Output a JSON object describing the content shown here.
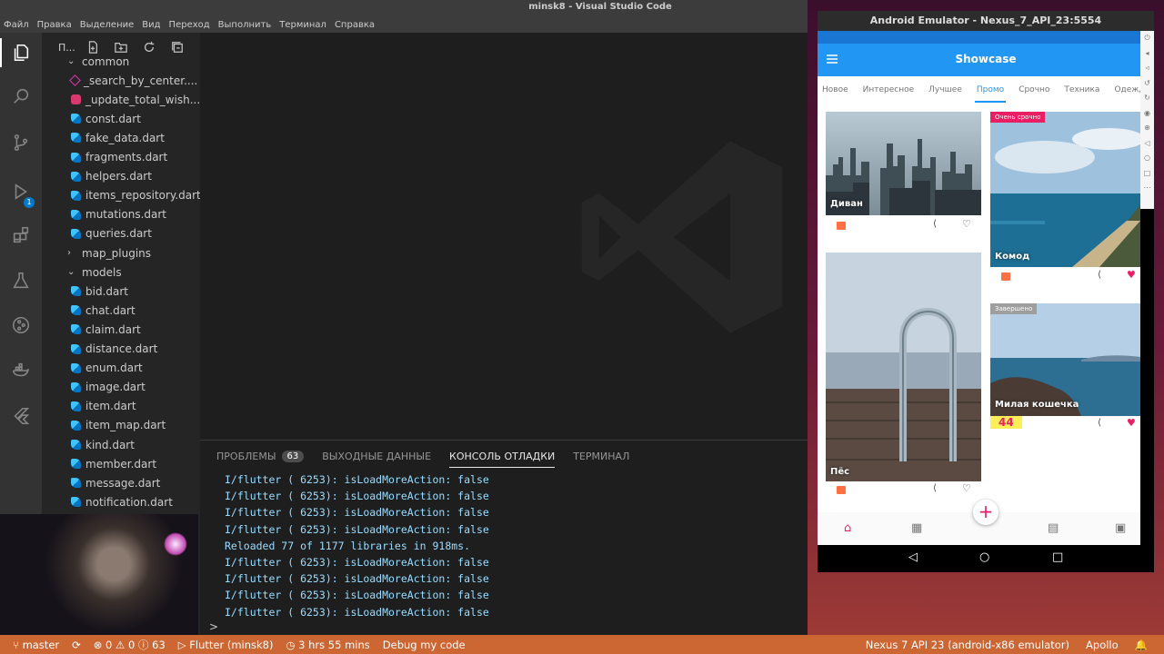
{
  "window": {
    "title": "minsk8 - Visual Studio Code"
  },
  "menu": [
    "Файл",
    "Правка",
    "Выделение",
    "Вид",
    "Переход",
    "Выполнить",
    "Терминал",
    "Справка"
  ],
  "activity": {
    "debug_badge": "1"
  },
  "sidebar": {
    "header": "П...",
    "tree": [
      {
        "label": "common",
        "kind": "folder-open",
        "indent": 1
      },
      {
        "label": "_search_by_center....",
        "kind": "graphql",
        "indent": 2
      },
      {
        "label": "_update_total_wish...",
        "kind": "db",
        "indent": 2
      },
      {
        "label": "const.dart",
        "kind": "dart",
        "indent": 2
      },
      {
        "label": "fake_data.dart",
        "kind": "dart",
        "indent": 2
      },
      {
        "label": "fragments.dart",
        "kind": "dart",
        "indent": 2
      },
      {
        "label": "helpers.dart",
        "kind": "dart",
        "indent": 2
      },
      {
        "label": "items_repository.dart",
        "kind": "dart",
        "indent": 2
      },
      {
        "label": "mutations.dart",
        "kind": "dart",
        "indent": 2
      },
      {
        "label": "queries.dart",
        "kind": "dart",
        "indent": 2
      },
      {
        "label": "map_plugins",
        "kind": "folder-closed",
        "indent": 1
      },
      {
        "label": "models",
        "kind": "folder-open",
        "indent": 1
      },
      {
        "label": "bid.dart",
        "kind": "dart",
        "indent": 2
      },
      {
        "label": "chat.dart",
        "kind": "dart",
        "indent": 2
      },
      {
        "label": "claim.dart",
        "kind": "dart",
        "indent": 2
      },
      {
        "label": "distance.dart",
        "kind": "dart",
        "indent": 2
      },
      {
        "label": "enum.dart",
        "kind": "dart",
        "indent": 2
      },
      {
        "label": "image.dart",
        "kind": "dart",
        "indent": 2
      },
      {
        "label": "item.dart",
        "kind": "dart",
        "indent": 2
      },
      {
        "label": "item_map.dart",
        "kind": "dart",
        "indent": 2
      },
      {
        "label": "kind.dart",
        "kind": "dart",
        "indent": 2
      },
      {
        "label": "member.dart",
        "kind": "dart",
        "indent": 2
      },
      {
        "label": "message.dart",
        "kind": "dart",
        "indent": 2
      },
      {
        "label": "notification.dart",
        "kind": "dart",
        "indent": 2
      }
    ]
  },
  "panel": {
    "tabs": [
      {
        "label": "ПРОБЛЕМЫ",
        "badge": "63",
        "active": false
      },
      {
        "label": "ВЫХОДНЫЕ ДАННЫЕ",
        "badge": "",
        "active": false
      },
      {
        "label": "КОНСОЛЬ ОТЛАДКИ",
        "badge": "",
        "active": true
      },
      {
        "label": "ТЕРМИНАЛ",
        "badge": "",
        "active": false
      }
    ],
    "console": [
      "I/flutter ( 6253): isLoadMoreAction: false",
      "I/flutter ( 6253): isLoadMoreAction: false",
      "I/flutter ( 6253): isLoadMoreAction: false",
      "I/flutter ( 6253): isLoadMoreAction: false",
      "Reloaded 77 of 1177 libraries in 918ms.",
      "I/flutter ( 6253): isLoadMoreAction: false",
      "I/flutter ( 6253): isLoadMoreAction: false",
      "I/flutter ( 6253): isLoadMoreAction: false",
      "I/flutter ( 6253): isLoadMoreAction: false"
    ],
    "prompt": ">"
  },
  "statusbar": {
    "branch": "master",
    "sync": "⟳",
    "problems": "⊗ 0 ⚠ 0 ⓘ 63",
    "debug_target": "▷ Flutter (minsk8)",
    "time": "◷ 3 hrs 55 mins",
    "debug_mode": "Debug my code",
    "device": "Nexus 7 API 23 (android-x86 emulator)",
    "apollo": "Apollo",
    "bell": "🔔"
  },
  "emulator": {
    "title": "Android Emulator - Nexus_7_API_23:5554",
    "app_title": "Showcase",
    "tabs": [
      {
        "label": "Новое",
        "active": false
      },
      {
        "label": "Интересное",
        "active": false
      },
      {
        "label": "Лучшее",
        "active": false
      },
      {
        "label": "Промо",
        "active": true
      },
      {
        "label": "Срочно",
        "active": false
      },
      {
        "label": "Техника",
        "active": false
      },
      {
        "label": "Одежда",
        "active": false
      }
    ],
    "cards": [
      {
        "name": "Диван",
        "tag": "",
        "price": "",
        "liked": false
      },
      {
        "name": "Комод",
        "tag": "Очень срочно",
        "price": "",
        "liked": true
      },
      {
        "name": "Пёс",
        "tag": "",
        "price": "",
        "liked": false
      },
      {
        "name": "Милая кошечка",
        "tag": "Завершено",
        "price": "44",
        "liked": true
      }
    ],
    "fab": "+",
    "colors": {
      "primary": "#2196f3",
      "accent": "#e91e63",
      "tag_urgent": "#e91e63",
      "tag_done": "#9e9e9e"
    }
  }
}
